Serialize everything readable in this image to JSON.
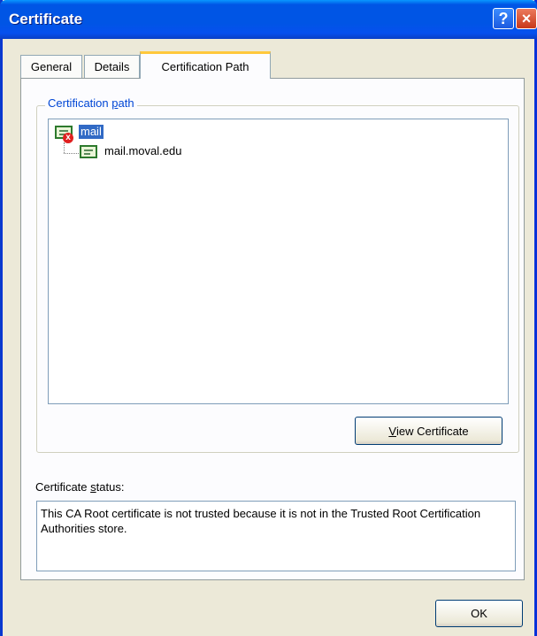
{
  "window": {
    "title": "Certificate",
    "help_label": "?",
    "close_label": "×"
  },
  "tabs": [
    {
      "label": "General"
    },
    {
      "label": "Details"
    },
    {
      "label": "Certification Path",
      "active": true
    }
  ],
  "certification_path": {
    "group_label_pre": "Certification ",
    "group_label_key": "p",
    "group_label_post": "ath",
    "nodes": [
      {
        "label": "mail",
        "selected": true,
        "status": "error",
        "icon": "certificate-error-icon"
      },
      {
        "label": "mail.moval.edu",
        "selected": false,
        "icon": "certificate-icon"
      }
    ],
    "view_button_key": "V",
    "view_button_rest": "iew Certificate"
  },
  "status": {
    "label_pre": "Certificate ",
    "label_key": "s",
    "label_post": "tatus:",
    "text": "This CA Root certificate is not trusted because it is not in the Trusted Root Certification Authorities store."
  },
  "footer": {
    "ok_label": "OK"
  },
  "colors": {
    "titlebar": "#0055e5",
    "dialog_bg": "#ece9d8",
    "selection": "#316ac5",
    "group_label": "#0046d5",
    "active_tab_highlight": "#ffc83c"
  }
}
